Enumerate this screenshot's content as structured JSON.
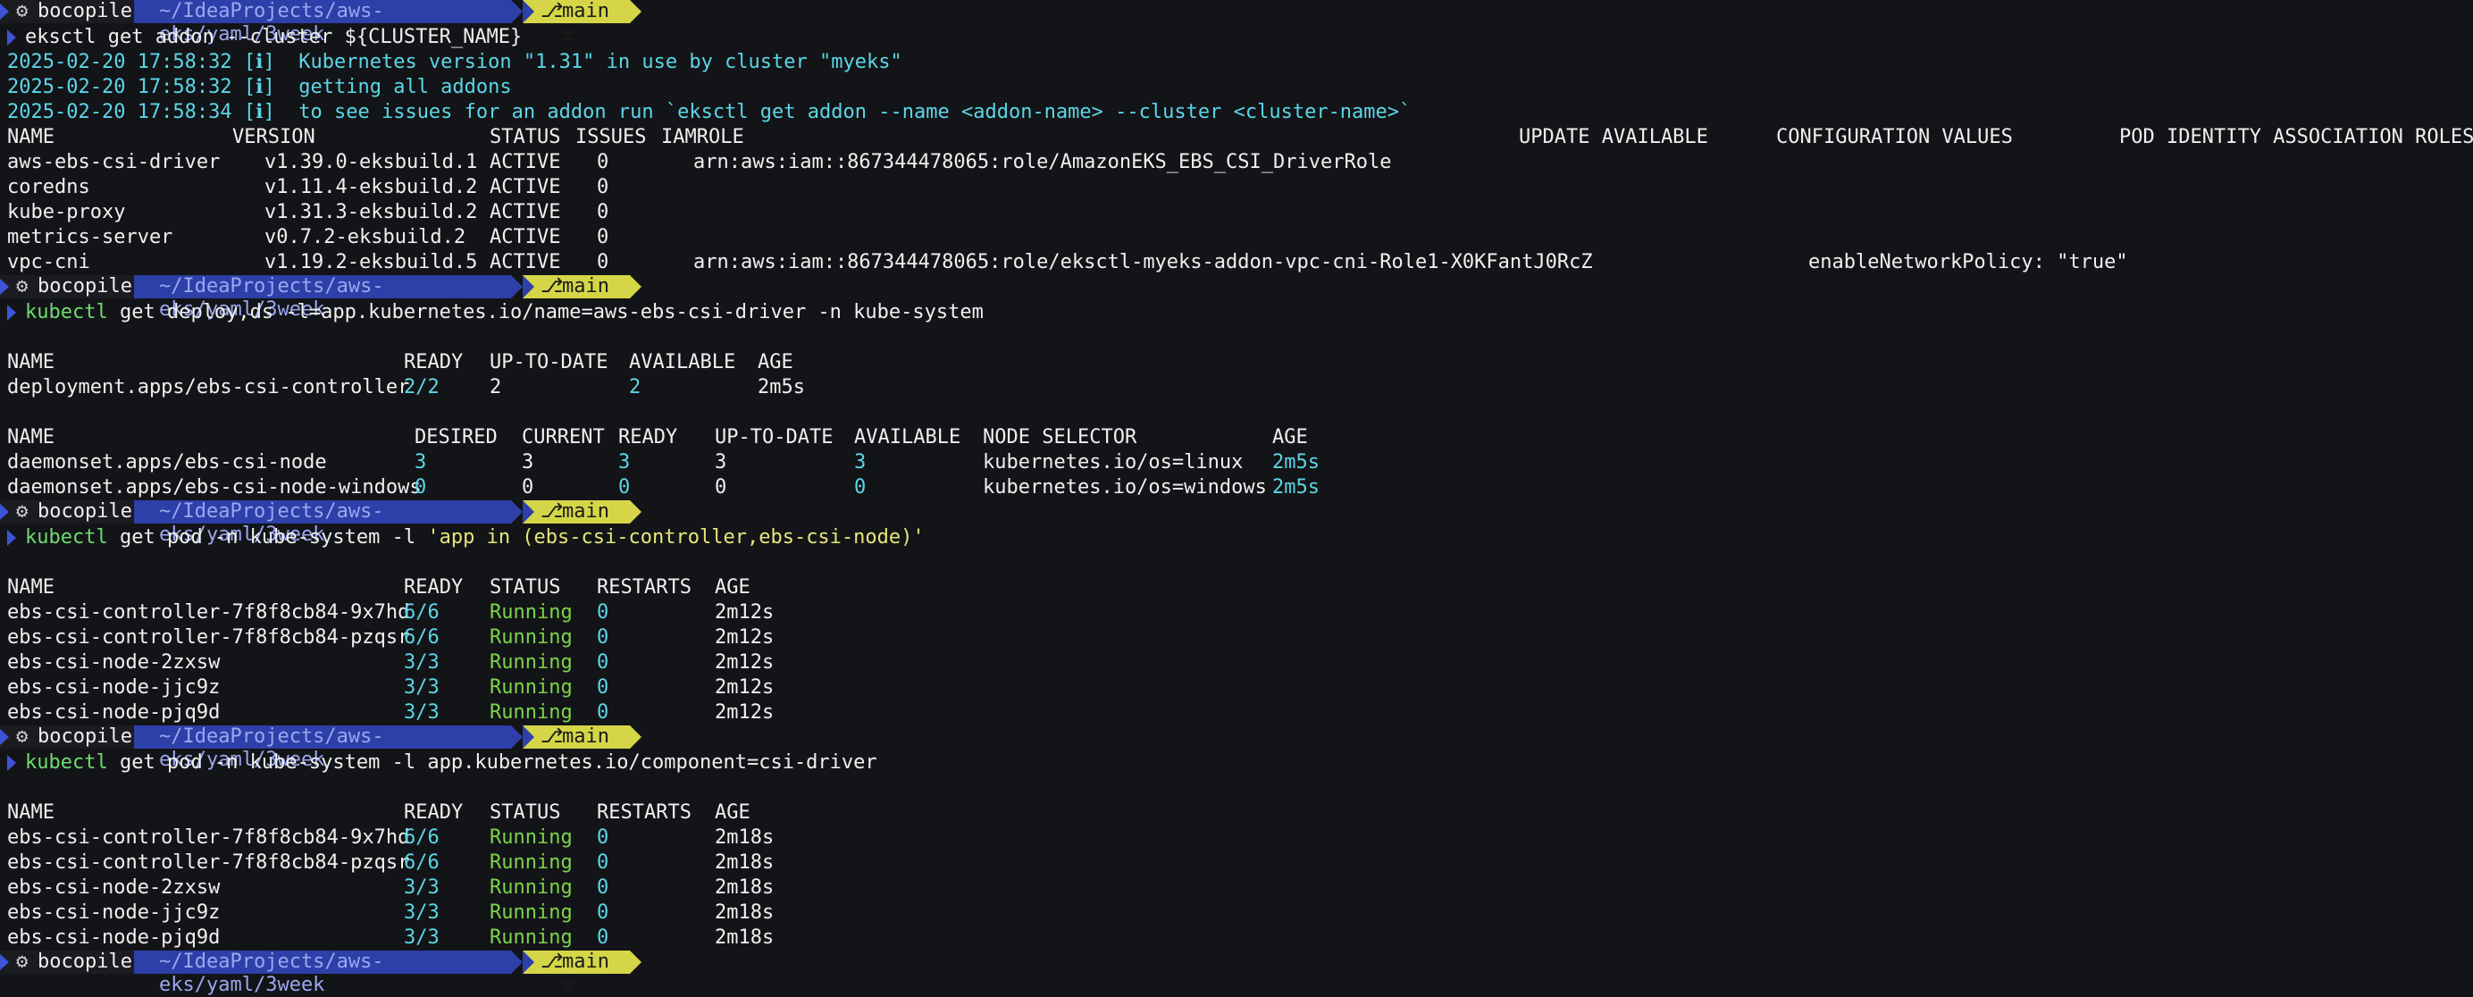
{
  "prompt": {
    "user": "bocopile",
    "path": "~/IdeaProjects/aws-eks/yaml/3week",
    "branch": "main ±"
  },
  "cmd1": {
    "text": "eksctl get addon --cluster ${CLUSTER_NAME}",
    "info": [
      "2025-02-20 17:58:32 [ℹ]  Kubernetes version \"1.31\" in use by cluster \"myeks\"",
      "2025-02-20 17:58:32 [ℹ]  getting all addons",
      "2025-02-20 17:58:34 [ℹ]  to see issues for an addon run `eksctl get addon --name <addon-name> --cluster <cluster-name>`"
    ],
    "headers": [
      "NAME",
      "VERSION",
      "STATUS",
      "ISSUES",
      "IAMROLE",
      "UPDATE AVAILABLE",
      "CONFIGURATION VALUES",
      "POD IDENTITY ASSOCIATION ROLES"
    ],
    "rows": [
      [
        "aws-ebs-csi-driver",
        "v1.39.0-eksbuild.1",
        "ACTIVE",
        "0",
        "arn:aws:iam::867344478065:role/AmazonEKS_EBS_CSI_DriverRole",
        ""
      ],
      [
        "coredns",
        "v1.11.4-eksbuild.2",
        "ACTIVE",
        "0",
        "",
        ""
      ],
      [
        "kube-proxy",
        "v1.31.3-eksbuild.2",
        "ACTIVE",
        "0",
        "",
        ""
      ],
      [
        "metrics-server",
        "v0.7.2-eksbuild.2",
        "ACTIVE",
        "0",
        "",
        ""
      ],
      [
        "vpc-cni",
        "v1.19.2-eksbuild.5",
        "ACTIVE",
        "0",
        "arn:aws:iam::867344478065:role/eksctl-myeks-addon-vpc-cni-Role1-X0KFantJ0RcZ",
        "enableNetworkPolicy: \"true\""
      ]
    ]
  },
  "cmd2": {
    "text": "get deploy,ds -l=app.kubernetes.io/name=aws-ebs-csi-driver -n kube-system",
    "kubectl": "kubectl",
    "deploy_headers": [
      "NAME",
      "READY",
      "UP-TO-DATE",
      "AVAILABLE",
      "AGE"
    ],
    "deploy_rows": [
      [
        "deployment.apps/ebs-csi-controller",
        "2/2",
        "2",
        "2",
        "2m5s"
      ]
    ],
    "ds_headers": [
      "NAME",
      "DESIRED",
      "CURRENT",
      "READY",
      "UP-TO-DATE",
      "AVAILABLE",
      "NODE SELECTOR",
      "AGE"
    ],
    "ds_rows": [
      [
        "daemonset.apps/ebs-csi-node",
        "3",
        "3",
        "3",
        "3",
        "3",
        "kubernetes.io/os=linux",
        "2m5s"
      ],
      [
        "daemonset.apps/ebs-csi-node-windows",
        "0",
        "0",
        "0",
        "0",
        "0",
        "kubernetes.io/os=windows",
        "2m5s"
      ]
    ]
  },
  "cmd3": {
    "kubectl": "kubectl",
    "text": "get pod -n kube-system -l ",
    "quoted": "'app in (ebs-csi-controller,ebs-csi-node)'",
    "headers": [
      "NAME",
      "READY",
      "STATUS",
      "RESTARTS",
      "AGE"
    ],
    "rows": [
      [
        "ebs-csi-controller-7f8f8cb84-9x7hd",
        "6/6",
        "Running",
        "0",
        "2m12s"
      ],
      [
        "ebs-csi-controller-7f8f8cb84-pzqsr",
        "6/6",
        "Running",
        "0",
        "2m12s"
      ],
      [
        "ebs-csi-node-2zxsw",
        "3/3",
        "Running",
        "0",
        "2m12s"
      ],
      [
        "ebs-csi-node-jjc9z",
        "3/3",
        "Running",
        "0",
        "2m12s"
      ],
      [
        "ebs-csi-node-pjq9d",
        "3/3",
        "Running",
        "0",
        "2m12s"
      ]
    ]
  },
  "cmd4": {
    "kubectl": "kubectl",
    "text": "get pod -n kube-system -l app.kubernetes.io/component=csi-driver",
    "headers": [
      "NAME",
      "READY",
      "STATUS",
      "RESTARTS",
      "AGE"
    ],
    "rows": [
      [
        "ebs-csi-controller-7f8f8cb84-9x7hd",
        "6/6",
        "Running",
        "0",
        "2m18s"
      ],
      [
        "ebs-csi-controller-7f8f8cb84-pzqsr",
        "6/6",
        "Running",
        "0",
        "2m18s"
      ],
      [
        "ebs-csi-node-2zxsw",
        "3/3",
        "Running",
        "0",
        "2m18s"
      ],
      [
        "ebs-csi-node-jjc9z",
        "3/3",
        "Running",
        "0",
        "2m18s"
      ],
      [
        "ebs-csi-node-pjq9d",
        "3/3",
        "Running",
        "0",
        "2m18s"
      ]
    ]
  }
}
